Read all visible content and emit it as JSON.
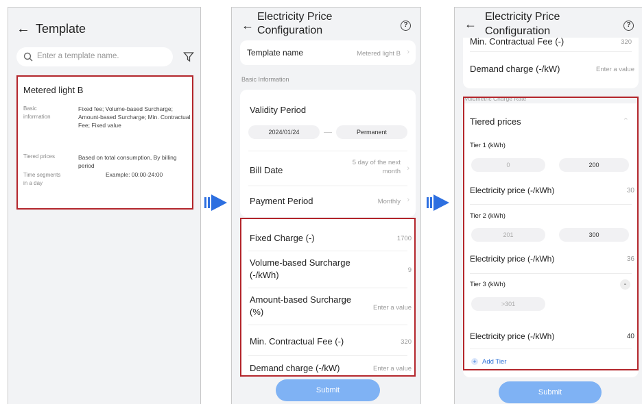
{
  "screen1": {
    "title": "Template",
    "search_placeholder": "Enter a template name.",
    "card": {
      "name": "Metered light B",
      "rows": [
        {
          "label": "Basic information",
          "value": "Fixed fee; Volume-based Surcharge; Amount-based Surcharge; Min. Contractual Fee; Fixed value"
        },
        {
          "label": "Tiered prices",
          "value": "Based on total consumption,  By billing period"
        },
        {
          "label": "Time segments in a day",
          "value": "Example:  00:00-24:00"
        }
      ]
    }
  },
  "screen2": {
    "title_line1": "Electricity Price",
    "title_line2": "Configuration",
    "help_icon": "?",
    "template_name_label": "Template name",
    "template_name_value": "Metered light B",
    "section_basic": "Basic Information",
    "validity_label": "Validity Period",
    "validity_start": "2024/01/24",
    "validity_end": "Permanent",
    "bill_date_label": "Bill Date",
    "bill_date_value": "5 day of the next month",
    "payment_label": "Payment Period",
    "payment_value": "Monthly",
    "fields": [
      {
        "label": "Fixed Charge (-)",
        "value": "1700"
      },
      {
        "label": "Volume-based Surcharge (-/kWh)",
        "value": "9"
      },
      {
        "label": "Amount-based Surcharge (%)",
        "value": "Enter a value"
      },
      {
        "label": "Min. Contractual Fee (-)",
        "value": "320"
      },
      {
        "label": "Demand charge (-/kW)",
        "value": "Enter a value"
      }
    ],
    "submit": "Submit"
  },
  "screen3": {
    "title_line1": "Electricity Price",
    "title_line2": "Configuration",
    "help_icon": "?",
    "min_fee_label": "Min. Contractual Fee (-)",
    "min_fee_value": "320",
    "demand_label": "Demand charge (-/kW)",
    "demand_value": "Enter a value",
    "section_volumetric": "Volumetric Charge Rate",
    "tiered_label": "Tiered prices",
    "tiers": [
      {
        "label": "Tier 1 (kWh)",
        "from": "0",
        "to": "200",
        "price_label": "Electricity price (-/kWh)",
        "price": "30"
      },
      {
        "label": "Tier 2 (kWh)",
        "from": "201",
        "to": "300",
        "price_label": "Electricity price (-/kWh)",
        "price": "36"
      },
      {
        "label": "Tier 3 (kWh)",
        "from": ">301",
        "to": "",
        "price_label": "Electricity price (-/kWh)",
        "price": "40"
      }
    ],
    "add_tier": "Add Tier",
    "submit": "Submit"
  },
  "colors": {
    "highlight_border": "#b3252b",
    "arrow": "#2d6fe0",
    "submit": "#7fb2f4",
    "link": "#2b6fd6"
  }
}
